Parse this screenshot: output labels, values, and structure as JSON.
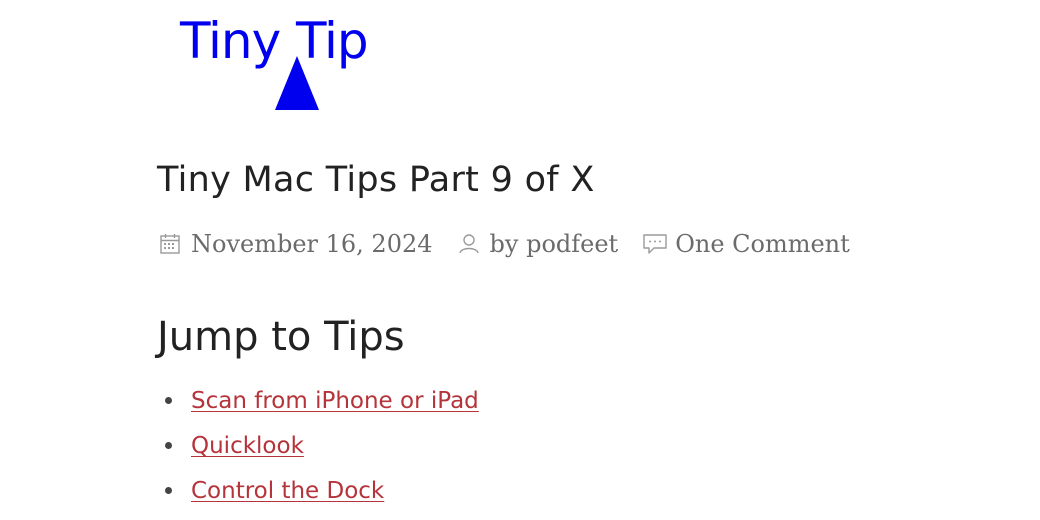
{
  "logo": {
    "text_left": "Tiny",
    "text_right": "Tip",
    "color": "#0000ee"
  },
  "post": {
    "title": "Tiny Mac Tips Part 9 of X",
    "meta": {
      "date": "November 16, 2024",
      "author_prefix": "by",
      "author": "podfeet",
      "comments": "One Comment",
      "icons": [
        "calendar-icon",
        "person-icon",
        "comment-icon"
      ]
    }
  },
  "tips": {
    "heading": "Jump to Tips",
    "links": [
      {
        "label": "Scan from iPhone or iPad"
      },
      {
        "label": "Quicklook"
      },
      {
        "label": "Control the Dock"
      }
    ],
    "link_color": "#b5333a"
  }
}
